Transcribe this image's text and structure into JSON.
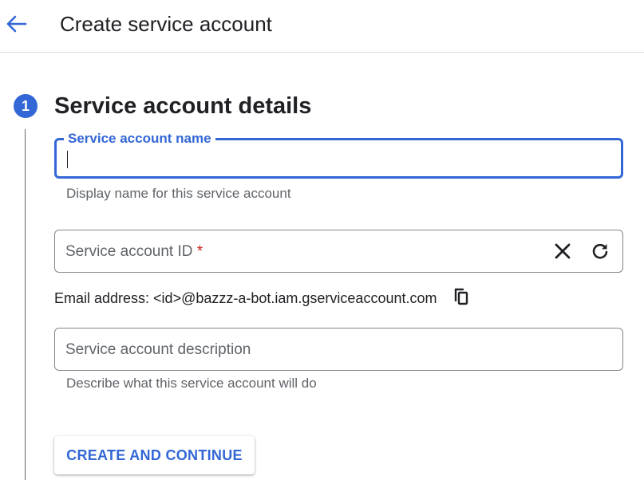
{
  "header": {
    "back_icon": "arrow-back-icon",
    "title": "Create service account"
  },
  "step": {
    "number": "1",
    "title": "Service account details"
  },
  "name_field": {
    "label": "Service account name",
    "value": "",
    "hint": "Display name for this service account",
    "focused": true
  },
  "id_field": {
    "placeholder": "Service account ID",
    "required_marker": "*",
    "clear_icon": "close-icon",
    "refresh_icon": "refresh-icon"
  },
  "email": {
    "text": "Email address: <id>@bazzz-a-bot.iam.gserviceaccount.com",
    "copy_icon": "copy-icon"
  },
  "description_field": {
    "placeholder": "Service account description",
    "hint": "Describe what this service account will do"
  },
  "actions": {
    "create_label": "CREATE AND CONTINUE"
  },
  "colors": {
    "accent": "#3367d6",
    "required": "#c5221f",
    "hint": "#5f6368"
  }
}
